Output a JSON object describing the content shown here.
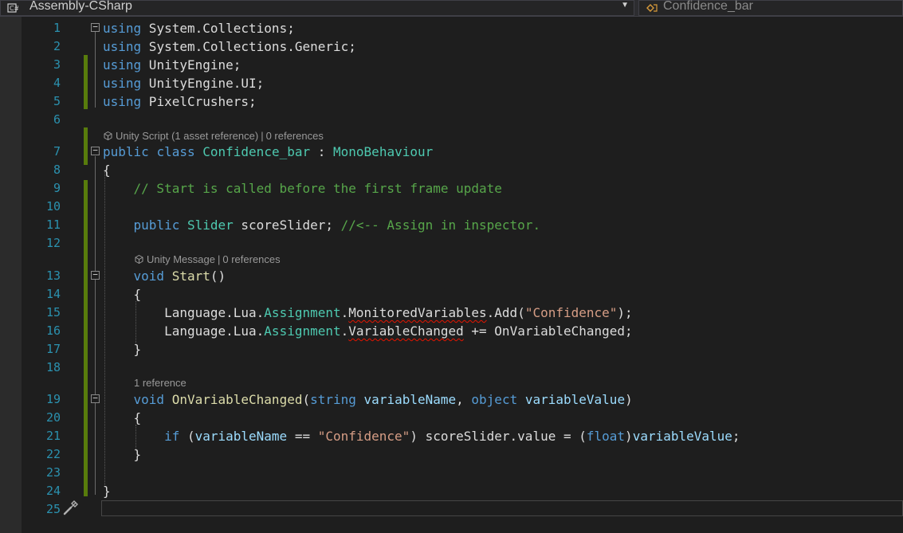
{
  "navbar": {
    "project": "Assembly-CSharp",
    "class_name": "Confidence_bar",
    "project_icon": "csharp-project-icon",
    "class_icon": "class-icon",
    "dropdown_icon": "chevron-down-icon"
  },
  "lens": {
    "class": {
      "text": "Unity Script (1 asset reference)",
      "sep": "|",
      "refs": "0 references"
    },
    "start": {
      "text": "Unity Message",
      "sep": "|",
      "refs": "0 references"
    },
    "handler": {
      "refs": "1 reference"
    }
  },
  "lines": [
    {
      "n": "1",
      "seg": [
        [
          "kw",
          "using"
        ],
        [
          "",
          " System.Collections;"
        ]
      ]
    },
    {
      "n": "2",
      "seg": [
        [
          "kw",
          "using"
        ],
        [
          "",
          " System.Collections.Generic;"
        ]
      ]
    },
    {
      "n": "3",
      "seg": [
        [
          "kw",
          "using"
        ],
        [
          "",
          " UnityEngine;"
        ]
      ]
    },
    {
      "n": "4",
      "seg": [
        [
          "kw",
          "using"
        ],
        [
          "",
          " UnityEngine.UI;"
        ]
      ]
    },
    {
      "n": "5",
      "seg": [
        [
          "kw",
          "using"
        ],
        [
          "",
          " PixelCrushers;"
        ]
      ]
    },
    {
      "n": "6",
      "seg": []
    },
    {
      "n": "7",
      "seg": [
        [
          "kw",
          "public"
        ],
        [
          "",
          " "
        ],
        [
          "kw",
          "class"
        ],
        [
          "",
          " "
        ],
        [
          "ty",
          "Confidence_bar"
        ],
        [
          "",
          " : "
        ],
        [
          "ty",
          "MonoBehaviour"
        ]
      ]
    },
    {
      "n": "8",
      "seg": [
        [
          "",
          "{"
        ]
      ]
    },
    {
      "n": "9",
      "seg": [
        [
          "",
          "    "
        ],
        [
          "cm",
          "// Start is called before the first frame update"
        ]
      ]
    },
    {
      "n": "10",
      "seg": []
    },
    {
      "n": "11",
      "seg": [
        [
          "",
          "    "
        ],
        [
          "kw",
          "public"
        ],
        [
          "",
          " "
        ],
        [
          "ty",
          "Slider"
        ],
        [
          "",
          " scoreSlider; "
        ],
        [
          "cm",
          "//<-- Assign in inspector."
        ]
      ]
    },
    {
      "n": "12",
      "seg": []
    },
    {
      "n": "13",
      "seg": [
        [
          "",
          "    "
        ],
        [
          "kw",
          "void"
        ],
        [
          "",
          " "
        ],
        [
          "mt",
          "Start"
        ],
        [
          "",
          "()"
        ]
      ]
    },
    {
      "n": "14",
      "seg": [
        [
          "",
          "    {"
        ]
      ]
    },
    {
      "n": "15",
      "seg": [
        [
          "",
          "        Language.Lua."
        ],
        [
          "ty",
          "Assignment"
        ],
        [
          "",
          "."
        ],
        [
          "sq",
          "MonitoredVariables"
        ],
        [
          "",
          ".Add("
        ],
        [
          "st",
          "\"Confidence\""
        ],
        [
          "",
          ");"
        ]
      ]
    },
    {
      "n": "16",
      "seg": [
        [
          "",
          "        Language.Lua."
        ],
        [
          "ty",
          "Assignment"
        ],
        [
          "",
          "."
        ],
        [
          "sq",
          "VariableChanged"
        ],
        [
          "",
          " += OnVariableChanged;"
        ]
      ]
    },
    {
      "n": "17",
      "seg": [
        [
          "",
          "    }"
        ]
      ]
    },
    {
      "n": "18",
      "seg": []
    },
    {
      "n": "19",
      "seg": [
        [
          "",
          "    "
        ],
        [
          "kw",
          "void"
        ],
        [
          "",
          " "
        ],
        [
          "mt",
          "OnVariableChanged"
        ],
        [
          "",
          "("
        ],
        [
          "kw",
          "string"
        ],
        [
          "",
          " "
        ],
        [
          "pm",
          "variableName"
        ],
        [
          "",
          ", "
        ],
        [
          "kw",
          "object"
        ],
        [
          "",
          " "
        ],
        [
          "pm",
          "variableValue"
        ],
        [
          "",
          ")"
        ]
      ]
    },
    {
      "n": "20",
      "seg": [
        [
          "",
          "    {"
        ]
      ]
    },
    {
      "n": "21",
      "seg": [
        [
          "",
          "        "
        ],
        [
          "kw",
          "if"
        ],
        [
          "",
          " ("
        ],
        [
          "pm",
          "variableName"
        ],
        [
          "",
          " == "
        ],
        [
          "st",
          "\"Confidence\""
        ],
        [
          "",
          ") scoreSlider.value = ("
        ],
        [
          "kw",
          "float"
        ],
        [
          "",
          ")"
        ],
        [
          "pm",
          "variableValue"
        ],
        [
          "",
          ";"
        ]
      ]
    },
    {
      "n": "22",
      "seg": [
        [
          "",
          "    }"
        ]
      ]
    },
    {
      "n": "23",
      "seg": []
    },
    {
      "n": "24",
      "seg": [
        [
          "",
          "}"
        ]
      ]
    },
    {
      "n": "25",
      "seg": []
    }
  ],
  "colors": {
    "background": "#1e1e1e",
    "keyword": "#569cd6",
    "type": "#4ec9b0",
    "comment": "#57a64a",
    "string": "#d69d85",
    "line_number": "#2b91af",
    "change_bar": "#587c0c"
  }
}
